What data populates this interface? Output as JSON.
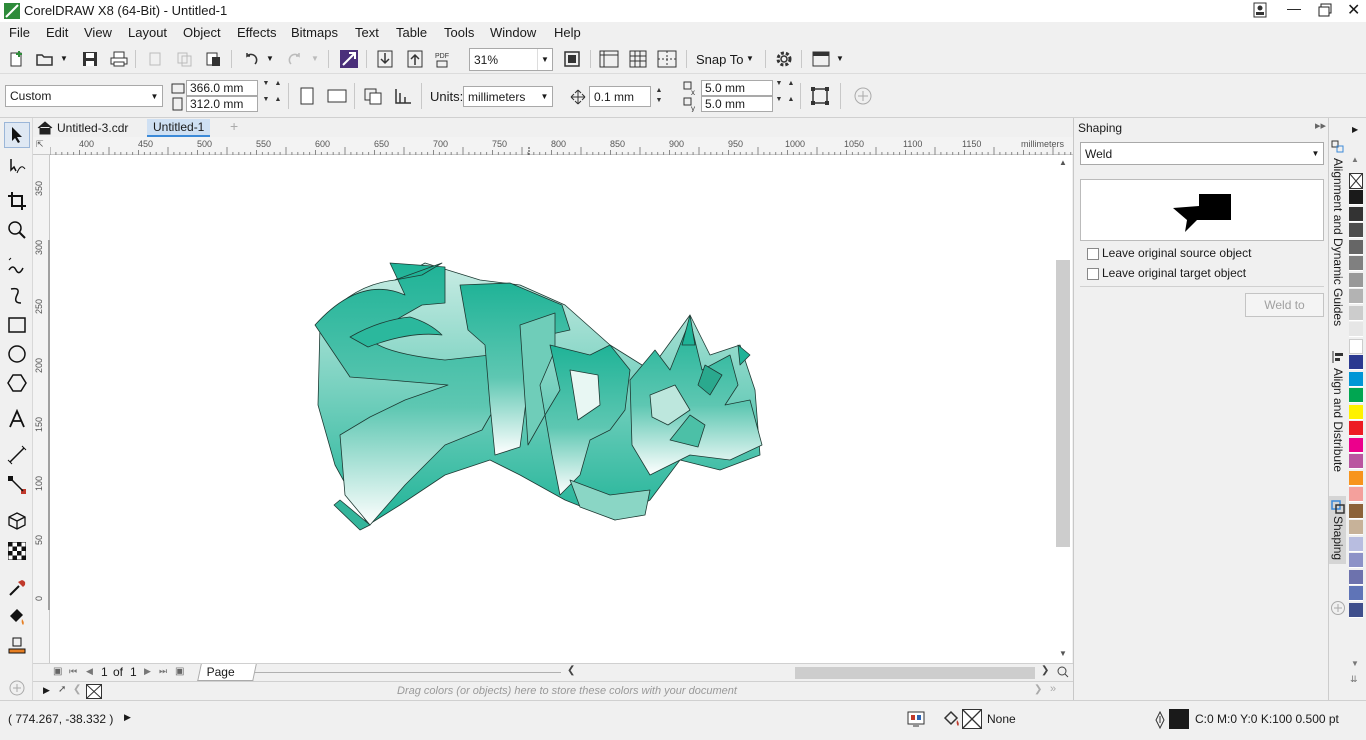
{
  "window": {
    "title": "CorelDRAW X8 (64-Bit) - Untitled-1"
  },
  "menu": [
    "File",
    "Edit",
    "View",
    "Layout",
    "Object",
    "Effects",
    "Bitmaps",
    "Text",
    "Table",
    "Tools",
    "Window",
    "Help"
  ],
  "toolbar": {
    "zoom": "31%",
    "snap_to": "Snap To"
  },
  "property_bar": {
    "page_preset": "Custom",
    "width": "366.0 mm",
    "height": "312.0 mm",
    "units_label": "Units:",
    "units": "millimeters",
    "nudge": "0.1 mm",
    "dup_x": "5.0 mm",
    "dup_y": "5.0 mm"
  },
  "doc_tabs": [
    "Untitled-3.cdr",
    "Untitled-1"
  ],
  "ruler": {
    "unit": "millimeters",
    "h_labels": [
      "400",
      "450",
      "500",
      "550",
      "600",
      "650",
      "700",
      "750",
      "800",
      "850",
      "900",
      "950",
      "1000",
      "1050",
      "1100",
      "1150"
    ],
    "v_labels": [
      "350",
      "300",
      "250",
      "200",
      "150",
      "100",
      "50",
      "0"
    ]
  },
  "page_nav": {
    "current": "1",
    "of": "of",
    "total": "1",
    "page_tab": "Page 1"
  },
  "doc_palette_hint": "Drag colors (or objects) here to store these colors with your document",
  "status": {
    "coords": "( 774.267, -38.332 )",
    "fill": "None",
    "outline": "C:0 M:0 Y:0 K:100  0.500 pt"
  },
  "docker": {
    "title": "Shaping",
    "mode": "Weld",
    "leave_source": "Leave original source object",
    "leave_target": "Leave original target object",
    "weld_button": "Weld to"
  },
  "docker_tabs": [
    "Alignment and Dynamic Guides",
    "Align and Distribute",
    "Shaping"
  ],
  "palette_colors": [
    "#1a1a1a",
    "#333333",
    "#4d4d4d",
    "#666666",
    "#808080",
    "#999999",
    "#b3b3b3",
    "#cccccc",
    "#e6e6e6",
    "#ffffff",
    "#2b3990",
    "#0096d6",
    "#00a651",
    "#fff200",
    "#ed1c24",
    "#ec008c",
    "#ba55a0",
    "#f7941d",
    "#f4a09c",
    "#8c6239",
    "#c7b299",
    "#b8bde0",
    "#8d92c7",
    "#6d72ad",
    "#5f74b7",
    "#3f4f8c"
  ],
  "accent": "#1fb397"
}
